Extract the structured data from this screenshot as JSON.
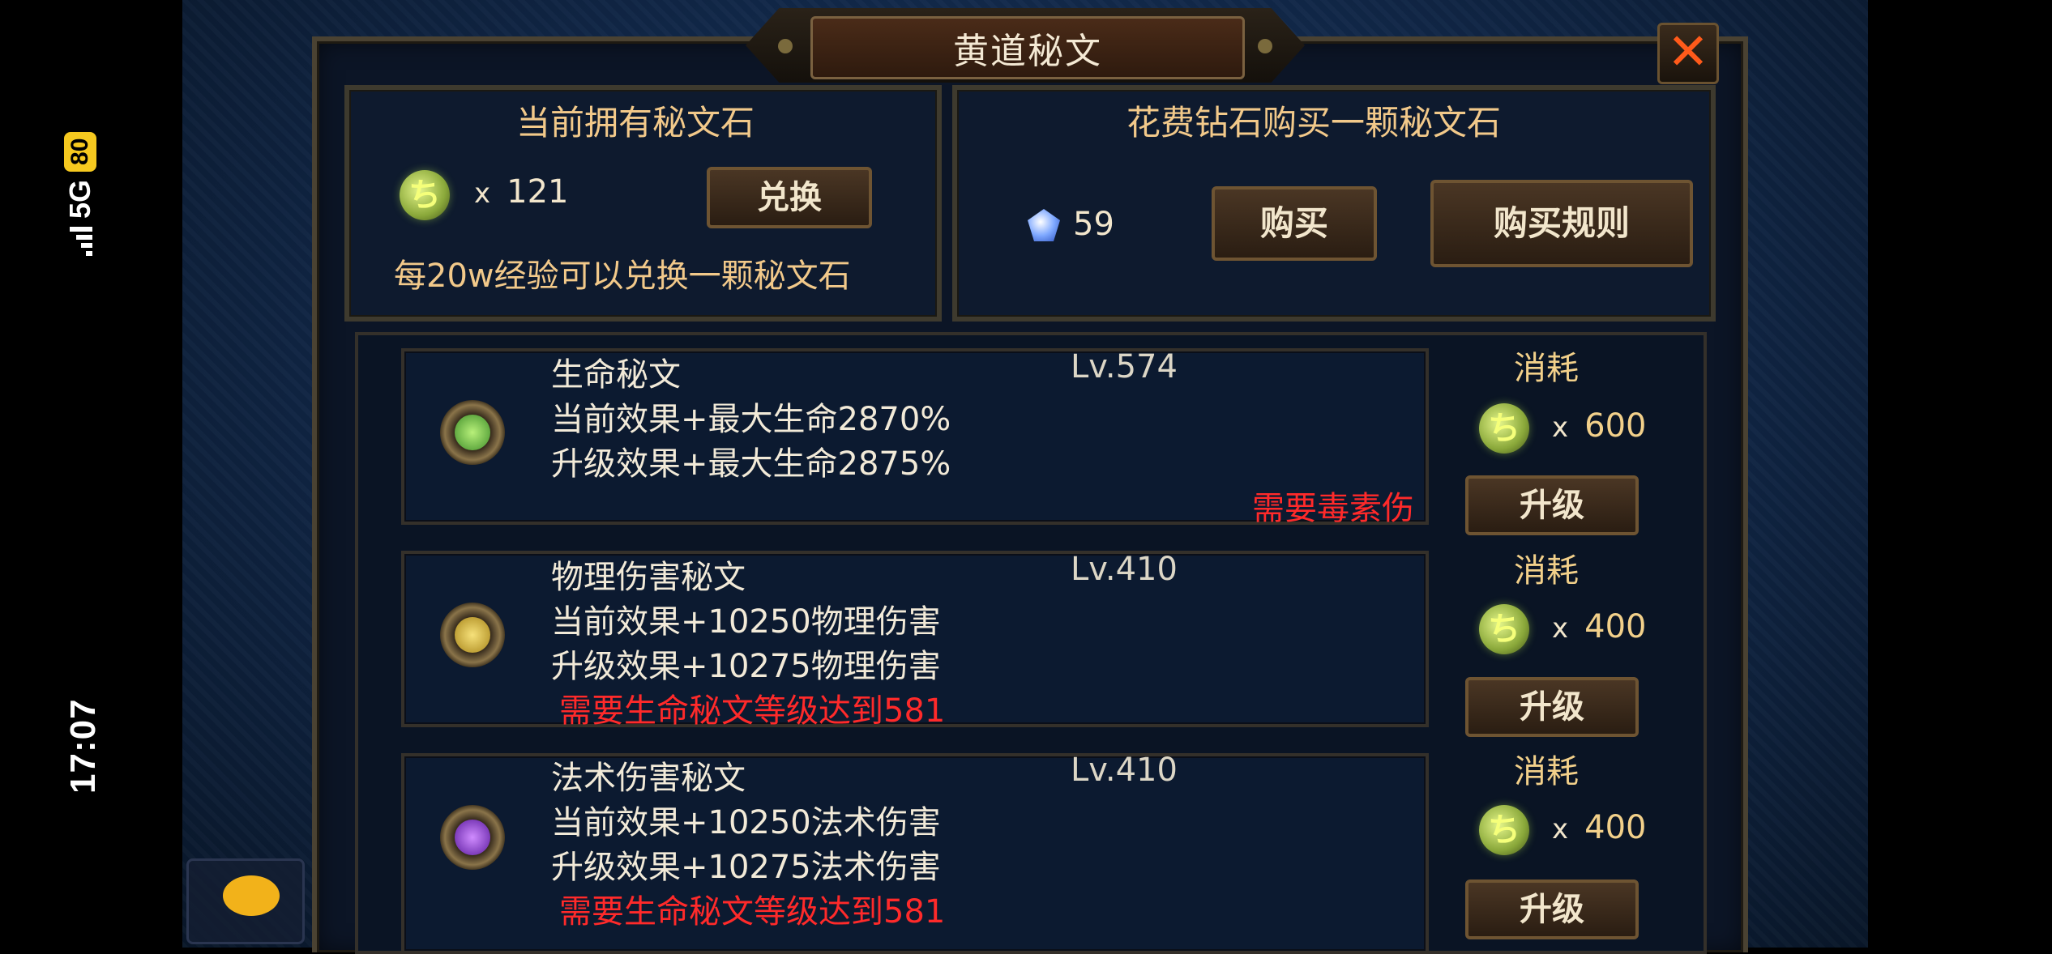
{
  "status_bar": {
    "time": "17:07",
    "network": "5G",
    "battery": "80"
  },
  "dialog": {
    "title": "黄道秘文"
  },
  "owned": {
    "title": "当前拥有秘文石",
    "count_prefix": "x",
    "count": "121",
    "exchange_label": "兑换",
    "note": "每20w经验可以兑换一颗秘文石"
  },
  "buy": {
    "title": "花费钻石购买一颗秘文石",
    "diamond_count": "59",
    "buy_label": "购买",
    "rules_label": "购买规则"
  },
  "runes": [
    {
      "name": "生命秘文",
      "level": "Lv.574",
      "current": "当前效果+最大生命2870%",
      "upgrade": "升级效果+最大生命2875%",
      "requirement": "需要毒素伤",
      "cost_label": "消耗",
      "cost_prefix": "x",
      "cost": "600",
      "upgrade_label": "升级",
      "icon": "leaf-icon"
    },
    {
      "name": "物理伤害秘文",
      "level": "Lv.410",
      "current": "当前效果+10250物理伤害",
      "upgrade": "升级效果+10275物理伤害",
      "requirement": "需要生命秘文等级达到581",
      "cost_label": "消耗",
      "cost_prefix": "x",
      "cost": "400",
      "upgrade_label": "升级",
      "icon": "sword-icon"
    },
    {
      "name": "法术伤害秘文",
      "level": "Lv.410",
      "current": "当前效果+10250法术伤害",
      "upgrade": "升级效果+10275法术伤害",
      "requirement": "需要生命秘文等级达到581",
      "cost_label": "消耗",
      "cost_prefix": "x",
      "cost": "400",
      "upgrade_label": "升级",
      "icon": "swirl-icon"
    }
  ],
  "stone_glyph": "ち",
  "colors": {
    "requirement": "#ff2a2a",
    "title_gold": "#f2c98a",
    "close": "#ff5a1a"
  }
}
